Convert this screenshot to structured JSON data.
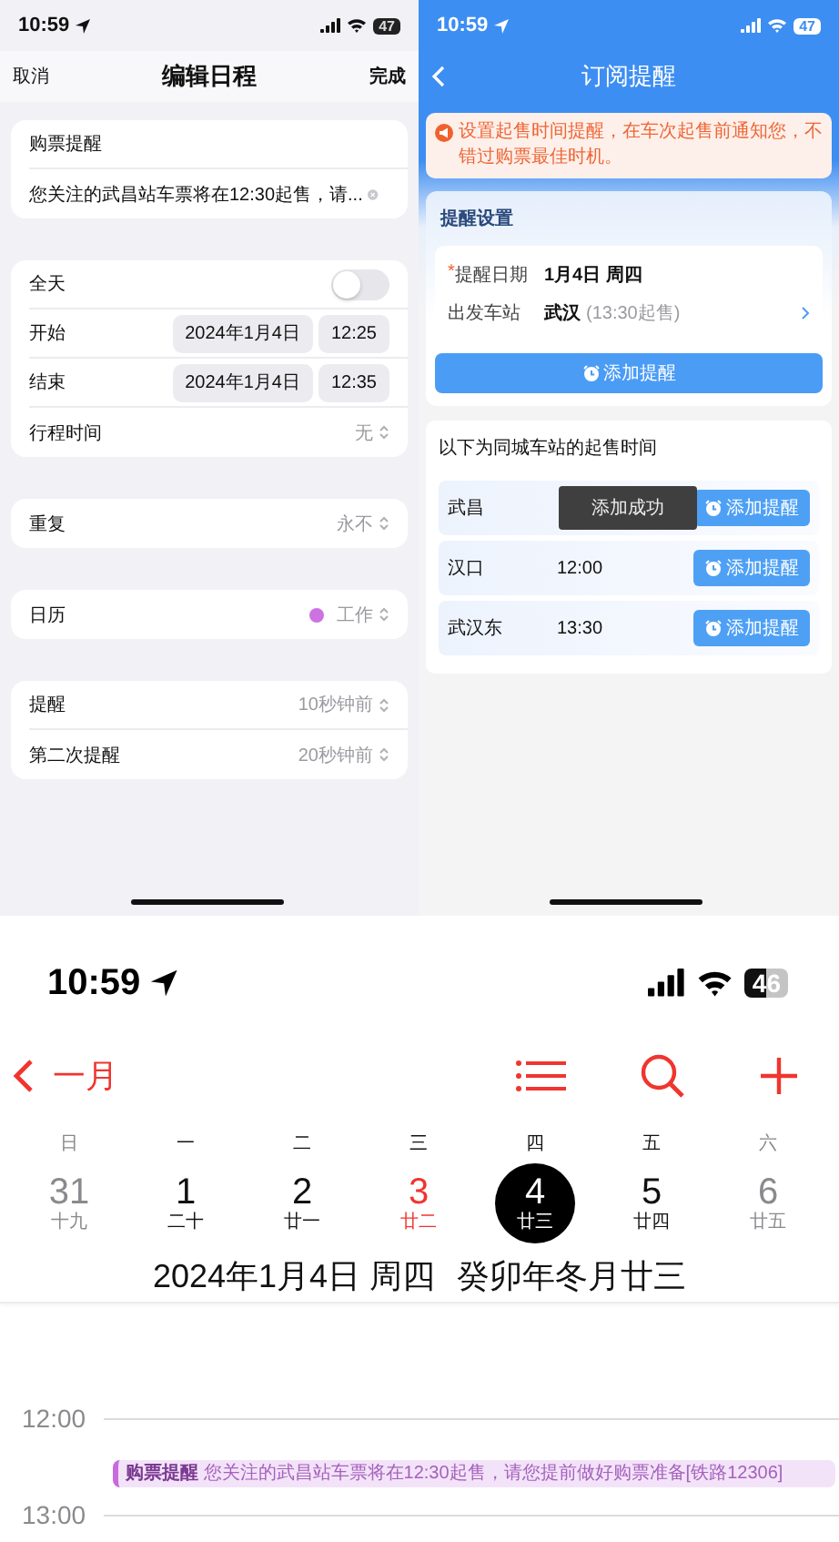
{
  "edit_event": {
    "status": {
      "time": "10:59",
      "battery": "47"
    },
    "nav": {
      "cancel": "取消",
      "title": "编辑日程",
      "done": "完成"
    },
    "sections": [
      {
        "rows": [
          {
            "kind": "text",
            "label": "购票提醒"
          },
          {
            "kind": "field",
            "value": "您关注的武昌站车票将在12:30起售，请..."
          }
        ]
      },
      {
        "rows": [
          {
            "kind": "toggle",
            "label": "全天",
            "on": false
          },
          {
            "kind": "datetime",
            "label": "开始",
            "date": "2024年1月4日",
            "time": "12:25"
          },
          {
            "kind": "datetime",
            "label": "结束",
            "date": "2024年1月4日",
            "time": "12:35"
          },
          {
            "kind": "select",
            "label": "行程时间",
            "value": "无"
          }
        ]
      },
      {
        "rows": [
          {
            "kind": "select",
            "label": "重复",
            "value": "永不"
          }
        ]
      },
      {
        "rows": [
          {
            "kind": "select",
            "label": "日历",
            "value": "工作",
            "color": "#cc73e1"
          }
        ]
      },
      {
        "rows": [
          {
            "kind": "select",
            "label": "提醒",
            "value": "10秒钟前"
          },
          {
            "kind": "select",
            "label": "第二次提醒",
            "value": "20秒钟前"
          }
        ]
      }
    ]
  },
  "subscribe": {
    "status": {
      "time": "10:59",
      "battery": "47"
    },
    "nav": {
      "title": "订阅提醒"
    },
    "notice": "设置起售时间提醒，在车次起售前通知您，不错过购票最佳时机。",
    "settings": {
      "title": "提醒设置",
      "rows": [
        {
          "mark": "*",
          "label": "提醒日期",
          "value": "1月4日 周四"
        },
        {
          "label": "出发车站",
          "value": "武汉",
          "note": "(13:30起售)",
          "link": true
        }
      ],
      "button": "添加提醒"
    },
    "stations": {
      "title": "以下为同城车站的起售时间",
      "rows": [
        {
          "name": "武昌",
          "button": "添加提醒"
        },
        {
          "name": "汉口",
          "time": "12:00",
          "button": "添加提醒"
        },
        {
          "name": "武汉东",
          "time": "13:30",
          "button": "添加提醒"
        }
      ]
    },
    "toast": "添加成功"
  },
  "calendar": {
    "status": {
      "time": "10:59",
      "battery": "46"
    },
    "nav": {
      "back": "一月"
    },
    "weekdays": [
      {
        "label": "日",
        "weekend": true
      },
      {
        "label": "一",
        "weekend": false
      },
      {
        "label": "二",
        "weekend": false
      },
      {
        "label": "三",
        "weekend": false
      },
      {
        "label": "四",
        "weekend": false
      },
      {
        "label": "五",
        "weekend": false
      },
      {
        "label": "六",
        "weekend": true
      }
    ],
    "days": [
      {
        "date": "31",
        "lunar": "十九",
        "weekend": true,
        "today": false,
        "selected": false
      },
      {
        "date": "1",
        "lunar": "二十",
        "weekend": false,
        "today": false,
        "selected": false
      },
      {
        "date": "2",
        "lunar": "廿一",
        "weekend": false,
        "today": false,
        "selected": false
      },
      {
        "date": "3",
        "lunar": "廿二",
        "weekend": false,
        "today": true,
        "selected": false
      },
      {
        "date": "4",
        "lunar": "廿三",
        "weekend": false,
        "today": false,
        "selected": true
      },
      {
        "date": "5",
        "lunar": "廿四",
        "weekend": false,
        "today": false,
        "selected": false
      },
      {
        "date": "6",
        "lunar": "廿五",
        "weekend": true,
        "today": false,
        "selected": false
      }
    ],
    "date_title": "2024年1月4日 周四",
    "lunar_title": "癸卯年冬月廿三",
    "timeline": [
      {
        "kind": "hour",
        "label": "12:00"
      },
      {
        "kind": "event",
        "text": "**购票提醒** 您关注的武昌站车票将在12:30起售，请您提前做好购票准备[铁路12306]",
        "color": "#c86bdc"
      },
      {
        "kind": "hour",
        "label": "13:00"
      }
    ]
  }
}
